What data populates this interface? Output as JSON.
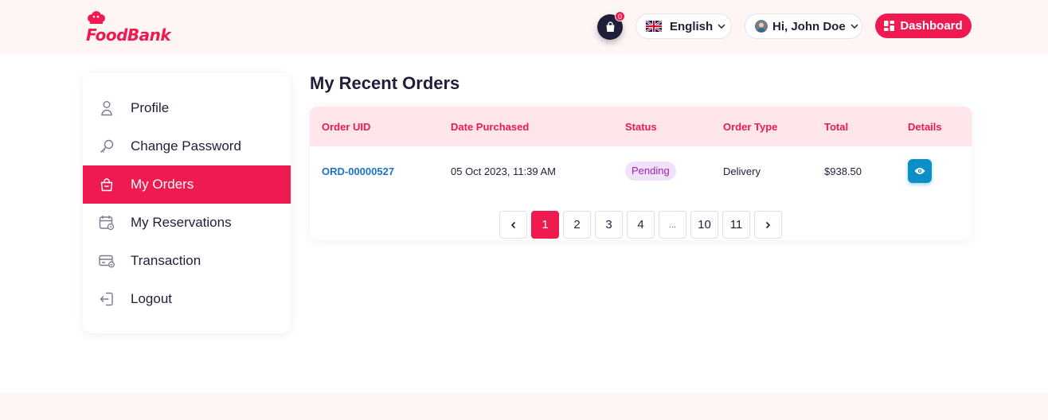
{
  "brand": {
    "name": "FoodBank",
    "color": "#ef1a4f"
  },
  "header": {
    "cart_count": "0",
    "language": "English",
    "greeting": "Hi, John Doe",
    "dashboard_label": "Dashboard"
  },
  "sidebar": {
    "items": [
      {
        "label": "Profile",
        "icon": "user-icon",
        "active": false
      },
      {
        "label": "Change Password",
        "icon": "key-icon",
        "active": false
      },
      {
        "label": "My Orders",
        "icon": "shopping-bag-icon",
        "active": true
      },
      {
        "label": "My Reservations",
        "icon": "calendar-icon",
        "active": false
      },
      {
        "label": "Transaction",
        "icon": "credit-card-icon",
        "active": false
      },
      {
        "label": "Logout",
        "icon": "logout-icon",
        "active": false
      }
    ]
  },
  "main": {
    "title": "My Recent Orders",
    "columns": [
      "Order UID",
      "Date Purchased",
      "Status",
      "Order Type",
      "Total",
      "Details"
    ],
    "rows": [
      {
        "uid": "ORD-00000527",
        "date": "05 Oct 2023, 11:39 AM",
        "status": "Pending",
        "type": "Delivery",
        "total": "$938.50"
      }
    ],
    "pagination": {
      "prev": "‹",
      "pages": [
        "1",
        "2",
        "3",
        "4",
        "...",
        "10",
        "11"
      ],
      "next": "›",
      "current": "1"
    }
  }
}
